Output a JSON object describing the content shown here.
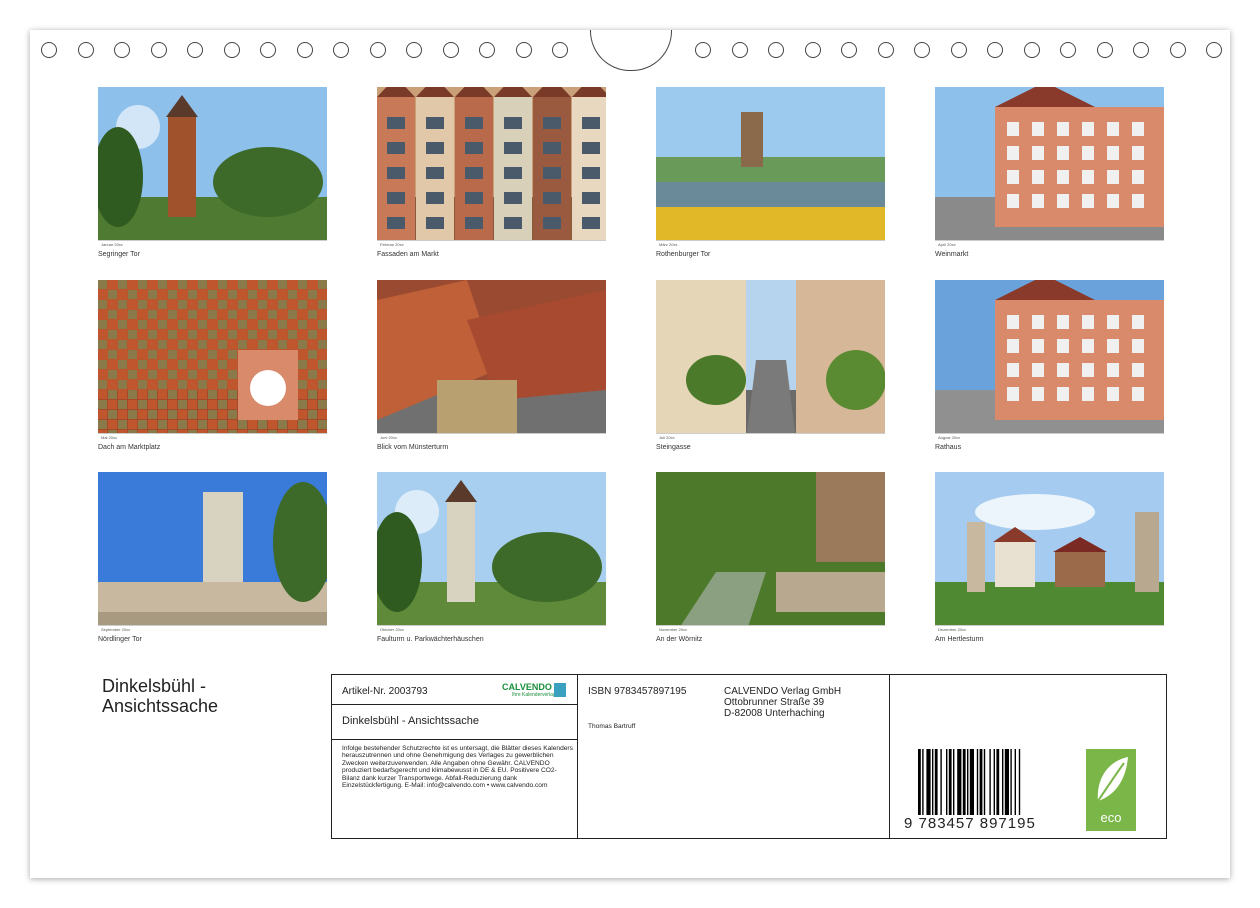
{
  "months": [
    {
      "caption": "Segringer Tor",
      "strip": "Januar 20xx"
    },
    {
      "caption": "Fassaden am Markt",
      "strip": "Februar 20xx"
    },
    {
      "caption": "Rothenburger Tor",
      "strip": "März 20xx"
    },
    {
      "caption": "Weinmarkt",
      "strip": "April 20xx"
    },
    {
      "caption": "Dach am Marktplatz",
      "strip": "Mai 20xx"
    },
    {
      "caption": "Blick vom Münsterturm",
      "strip": "Juni 20xx"
    },
    {
      "caption": "Steingasse",
      "strip": "Juli 20xx"
    },
    {
      "caption": "Rathaus",
      "strip": "August 20xx"
    },
    {
      "caption": "Nördlinger Tor",
      "strip": "September 20xx"
    },
    {
      "caption": "Faulturm u. Parkwächterhäuschen",
      "strip": "Oktober 20xx"
    },
    {
      "caption": "An der Wörnitz",
      "strip": "November 20xx"
    },
    {
      "caption": "Am Hertlesturm",
      "strip": "Dezember 20xx"
    }
  ],
  "title_line1": "Dinkelsbühl -",
  "title_line2": "Ansichtssache",
  "info": {
    "artikel": "Artikel-Nr. 2003793",
    "logo": "CALVENDO",
    "logo_sub": "Ihre Kalenderverlag",
    "subtitle": "Dinkelsbühl - Ansichtssache",
    "legal": "Infolge bestehender Schutzrechte ist es untersagt, die Blätter dieses Kalenders herauszutrennen und ohne Genehmigung des Verlages zu gewerblichen Zwecken weiterzuverwenden. Alle Angaben ohne Gewähr. CALVENDO produziert bedarfsgerecht und klimabewusst in DE & EU. Positivere CO2-Bilanz dank kurzer Transportwege. Abfall-Reduzierung dank Einzelstückfertigung. E-Mail: info@calvendo.com • www.calvendo.com",
    "isbn": "ISBN 9783457897195",
    "publisher_line1": "CALVENDO Verlag GmbH",
    "publisher_line2": "Ottobrunner Straße 39",
    "publisher_line3": "D-82008 Unterhaching",
    "author": "Thomas Bartruff",
    "barcode_number": "9 783457 897195",
    "eco_label": "eco"
  },
  "colors": {
    "eco_green": "#7ab648",
    "calvendo_green": "#1a8f3c"
  }
}
